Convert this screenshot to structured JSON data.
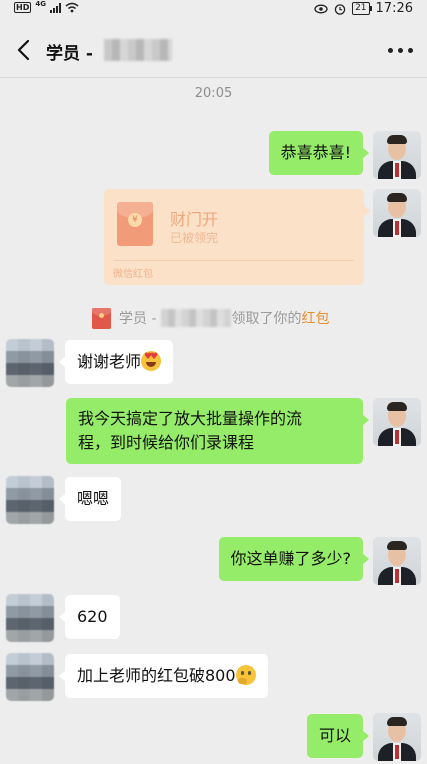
{
  "status_bar": {
    "hd": "HD",
    "network": "4G",
    "battery": "21",
    "time": "17:26"
  },
  "header": {
    "title": "学员 -"
  },
  "timestamp": "20:05",
  "red_packet": {
    "title": "财门开",
    "status": "已被领完",
    "label": "微信红包"
  },
  "notice": {
    "prefix": "学员 -",
    "middle": "领取了你的",
    "link": "红包"
  },
  "messages": [
    {
      "from": "teacher",
      "text": "恭喜恭喜!"
    },
    {
      "from": "student",
      "text": "谢谢老师",
      "emoji": "heart-eyes-icon"
    },
    {
      "from": "teacher",
      "lines": [
        "我今天搞定了放大批量操作的流",
        "程，到时候给你们录课程"
      ]
    },
    {
      "from": "student",
      "text": "嗯嗯"
    },
    {
      "from": "teacher",
      "text": "你这单赚了多少?"
    },
    {
      "from": "student",
      "text": "620"
    },
    {
      "from": "student",
      "text": "加上老师的红包破800",
      "emoji": "thinking-face-icon"
    },
    {
      "from": "teacher",
      "text": "可以"
    }
  ]
}
